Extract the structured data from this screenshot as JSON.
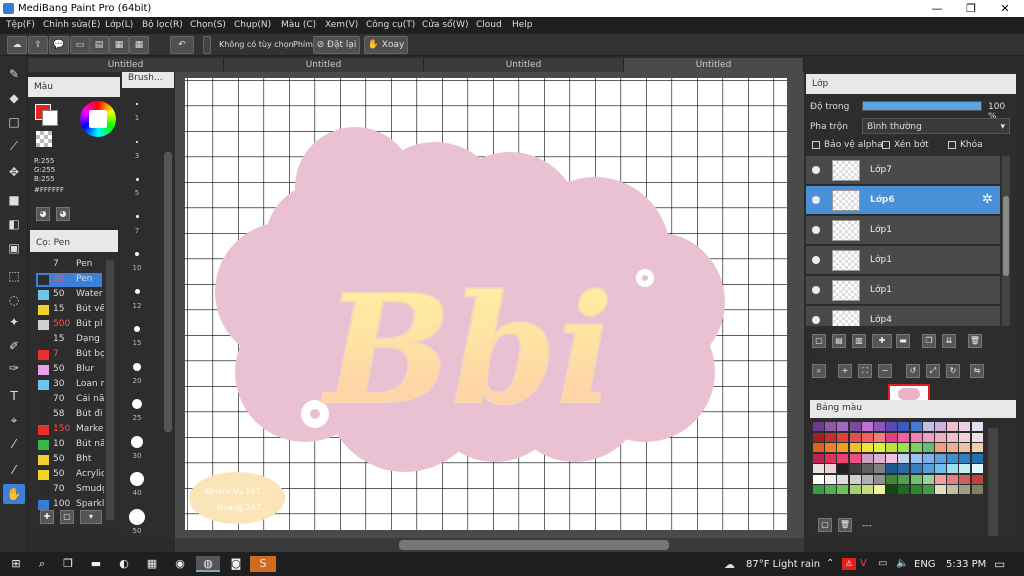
{
  "window": {
    "title": "MediBang Paint Pro (64bit)",
    "min": "—",
    "max": "❐",
    "close": "✕"
  },
  "menu": [
    "Tệp(F)",
    "Chỉnh sửa(E)",
    "Lớp(L)",
    "Bộ lọc(R)",
    "Chọn(S)",
    "Chụp(N)",
    "Màu (C)",
    "Xem(V)",
    "Công cụ(T)",
    "Cửa sổ(W)",
    "Cloud",
    "Help"
  ],
  "toolbar": {
    "no_selection": "Không có tùy chọn",
    "keys_label": "Phím",
    "reset_label": "Đặt lại",
    "rotate_label": "Xoay"
  },
  "tabs": [
    "Untitled",
    "Untitled",
    "Untitled",
    "Untitled"
  ],
  "color_panel": {
    "title": "Màu",
    "r": "R:255",
    "g": "G:255",
    "b": "B:255",
    "hex": "#FFFFFF",
    "primary": "#e8231c",
    "secondary": "#ffffff"
  },
  "brush_size_panel": {
    "title": "Brush...",
    "sizes": [
      "1",
      "3",
      "5",
      "7",
      "10",
      "12",
      "15",
      "20",
      "25",
      "30",
      "40",
      "50"
    ]
  },
  "brush_panel": {
    "title": "Cọ: Pen",
    "rows": [
      {
        "num": "7",
        "name": "Pen",
        "color": "#2b2b2b",
        "red": false
      },
      {
        "num": "30",
        "name": "Pen",
        "color": "#2b2b2b",
        "red": true,
        "selected": true
      },
      {
        "num": "50",
        "name": "Water",
        "color": "#6ec6f0",
        "red": false
      },
      {
        "num": "15",
        "name": "Bút vẽ",
        "color": "#f2d12e",
        "red": false
      },
      {
        "num": "500",
        "name": "Bút pl",
        "color": "#d0d0d0",
        "red": true
      },
      {
        "num": "15",
        "name": "Dạng",
        "color": "#2b2b2b",
        "red": false
      },
      {
        "num": "7",
        "name": "Bút bọ",
        "color": "#e83030",
        "red": true
      },
      {
        "num": "50",
        "name": "Blur",
        "color": "#e8a0e8",
        "red": false
      },
      {
        "num": "30",
        "name": "Loan m",
        "color": "#6ec6f0",
        "red": false
      },
      {
        "num": "70",
        "name": "Cái nã",
        "color": "#2b2b2b",
        "red": false
      },
      {
        "num": "58",
        "name": "Bút đi",
        "color": "#2b2b2b",
        "red": false
      },
      {
        "num": "150",
        "name": "Marke",
        "color": "#e83030",
        "red": true
      },
      {
        "num": "10",
        "name": "Bút nã",
        "color": "#39b54a",
        "red": false
      },
      {
        "num": "50",
        "name": "Bht",
        "color": "#f2d12e",
        "red": false
      },
      {
        "num": "50",
        "name": "Acrylic",
        "color": "#f2d12e",
        "red": false
      },
      {
        "num": "70",
        "name": "Smudg",
        "color": "#2b2b2b",
        "red": false
      },
      {
        "num": "100",
        "name": "Sparkl",
        "color": "#3a7bd5",
        "red": false
      }
    ]
  },
  "layer_panel": {
    "title": "Lớp",
    "opacity_label": "Độ trong",
    "opacity_value": "100 %",
    "opacity_fraction": 1.0,
    "blend_label": "Pha trộn",
    "blend_value": "Bình thường",
    "protect_alpha": "Bảo vệ alpha",
    "clipping": "Xén bớt",
    "lock": "Khóa",
    "layers": [
      {
        "name": "Lớp7",
        "selected": false
      },
      {
        "name": "Lớp6",
        "selected": true
      },
      {
        "name": "Lớp1",
        "selected": false
      },
      {
        "name": "Lớp1",
        "selected": false
      },
      {
        "name": "Lớp1",
        "selected": false
      },
      {
        "name": "Lớp4",
        "selected": false
      }
    ]
  },
  "palette_panel": {
    "title": "Bảng màu",
    "footer": "---"
  },
  "artwork": {
    "text": "Bbi",
    "credit_line1": "Khiem Vu 197",
    "credit_line2": "Hoang 247"
  },
  "taskbar": {
    "weather": "87°F  Light rain",
    "lang": "ENG",
    "time": "5:33 PM"
  }
}
